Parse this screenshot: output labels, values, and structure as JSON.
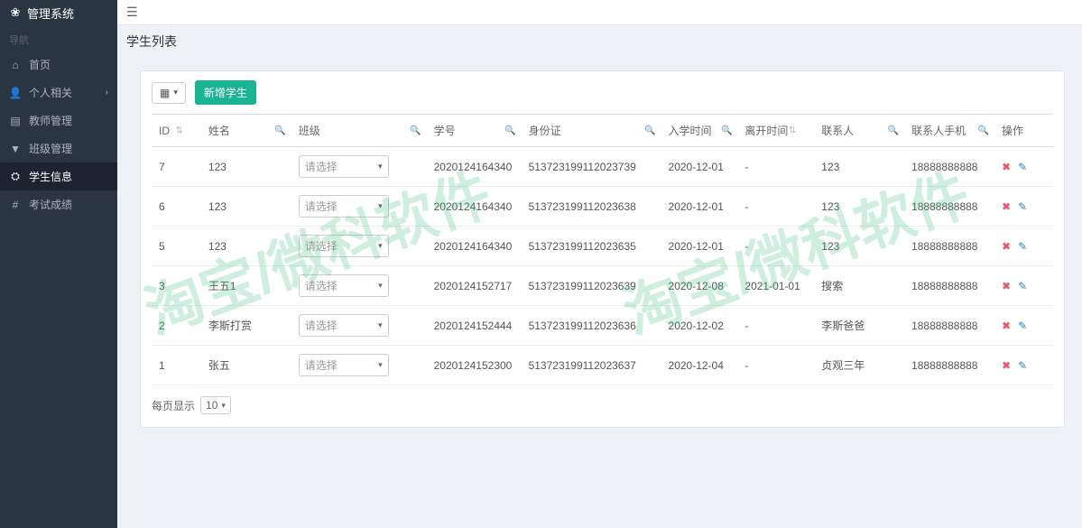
{
  "app_title": "管理系统",
  "nav": {
    "section": "导航",
    "items": [
      {
        "icon": "home",
        "label": "首页",
        "chev": false
      },
      {
        "icon": "user",
        "label": "个人相关",
        "chev": true
      },
      {
        "icon": "doc",
        "label": "教师管理",
        "chev": false
      },
      {
        "icon": "filter",
        "label": "班级管理",
        "chev": false
      },
      {
        "icon": "group",
        "label": "学生信息",
        "chev": false,
        "active": true
      },
      {
        "icon": "hash",
        "label": "考试成绩",
        "chev": false
      }
    ]
  },
  "page_title": "学生列表",
  "toolbar": {
    "add_label": "新增学生",
    "columns_label": ""
  },
  "columns": [
    {
      "label": "ID",
      "sortable": true,
      "searchable": false
    },
    {
      "label": "姓名",
      "sortable": false,
      "searchable": true
    },
    {
      "label": "班级",
      "sortable": false,
      "searchable": true
    },
    {
      "label": "学号",
      "sortable": false,
      "searchable": true
    },
    {
      "label": "身份证",
      "sortable": false,
      "searchable": true
    },
    {
      "label": "入学时间",
      "sortable": false,
      "searchable": true
    },
    {
      "label": "离开时间",
      "sortable": true,
      "searchable": false
    },
    {
      "label": "联系人",
      "sortable": false,
      "searchable": true
    },
    {
      "label": "联系人手机",
      "sortable": false,
      "searchable": true
    },
    {
      "label": "操作",
      "sortable": false,
      "searchable": false
    }
  ],
  "select_placeholder": "请选择",
  "rows": [
    {
      "id": "7",
      "name": "123",
      "sno": "2020124164340",
      "idno": "513723199112023739",
      "in": "2020-12-01",
      "out": "-",
      "contact": "123",
      "phone": "18888888888"
    },
    {
      "id": "6",
      "name": "123",
      "sno": "2020124164340",
      "idno": "513723199112023638",
      "in": "2020-12-01",
      "out": "-",
      "contact": "123",
      "phone": "18888888888"
    },
    {
      "id": "5",
      "name": "123",
      "sno": "2020124164340",
      "idno": "513723199112023635",
      "in": "2020-12-01",
      "out": "-",
      "contact": "123",
      "phone": "18888888888"
    },
    {
      "id": "3",
      "name": "王五1",
      "sno": "2020124152717",
      "idno": "513723199112023639",
      "in": "2020-12-08",
      "out": "2021-01-01",
      "contact": "搜索",
      "phone": "18888888888"
    },
    {
      "id": "2",
      "name": "李斯打赏",
      "sno": "2020124152444",
      "idno": "513723199112023636",
      "in": "2020-12-02",
      "out": "-",
      "contact": "李斯爸爸",
      "phone": "18888888888"
    },
    {
      "id": "1",
      "name": "张五",
      "sno": "2020124152300",
      "idno": "513723199112023637",
      "in": "2020-12-04",
      "out": "-",
      "contact": "贞观三年",
      "phone": "18888888888"
    }
  ],
  "pager": {
    "label": "每页显示",
    "value": "10"
  },
  "watermark": "淘宝/微科软件"
}
